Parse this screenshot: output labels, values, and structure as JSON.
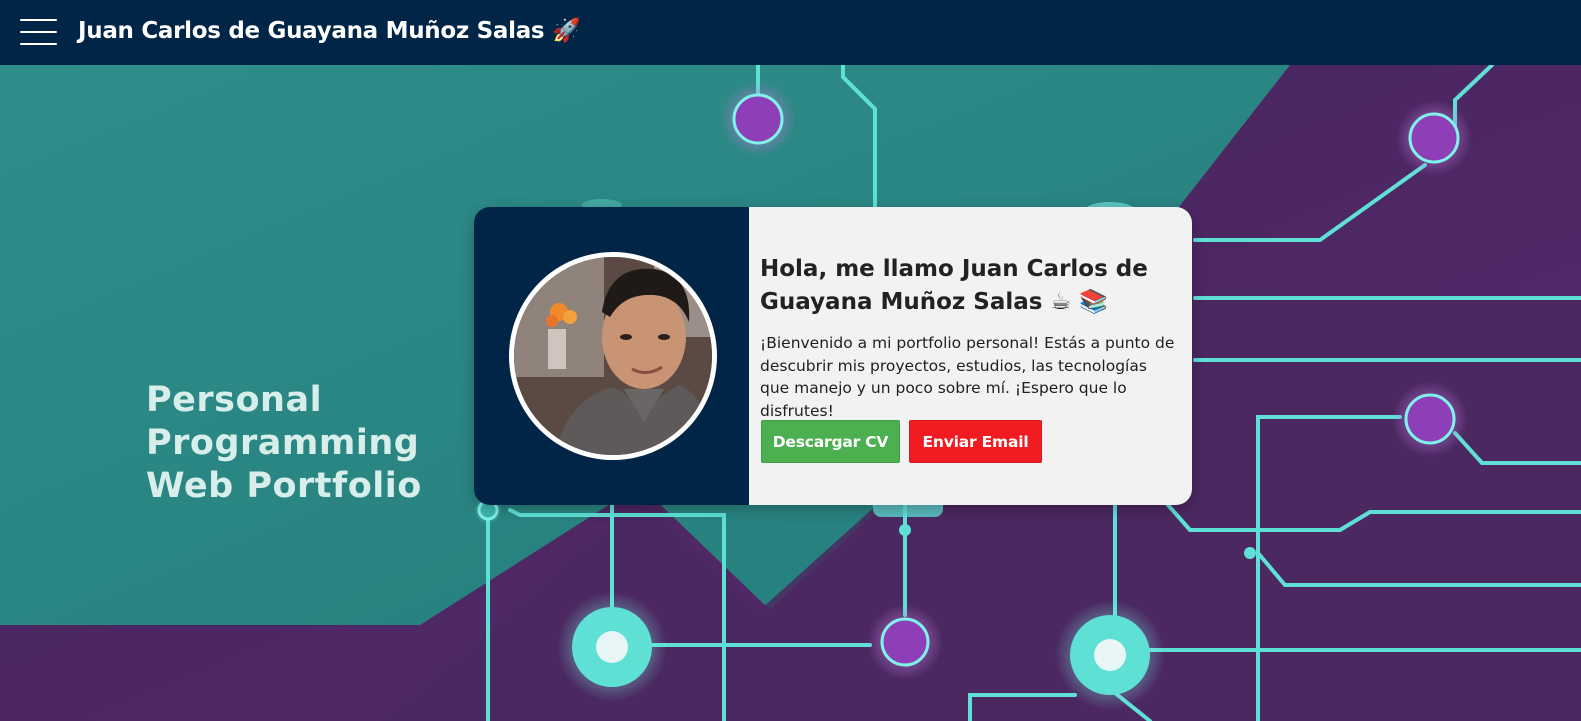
{
  "navbar": {
    "title": "Juan Carlos de Guayana Muñoz Salas 🚀",
    "menu_icon": "hamburger-menu-icon"
  },
  "hero": {
    "tagline": [
      "Personal",
      "Programming",
      "Web Portfolio"
    ],
    "colors": {
      "teal": "#2a8a86",
      "purple": "#4a2860",
      "circuit": "#5ee0d6",
      "node": "#8e3fb8"
    }
  },
  "intro": {
    "heading": "Hola, me llamo Juan Carlos de Guayana Muñoz Salas ☕ 📚",
    "text": "¡Bienvenido a mi portfolio personal! Estás a punto de descubrir mis proyectos, estudios, las tecnologías que manejo y un poco sobre mí. ¡Espero que lo disfrutes!",
    "buttons": {
      "cv": "Descargar CV",
      "email": "Enviar Email"
    },
    "colors": {
      "panel": "#002546",
      "cv": "#4caf50",
      "email": "#f11c21"
    }
  }
}
